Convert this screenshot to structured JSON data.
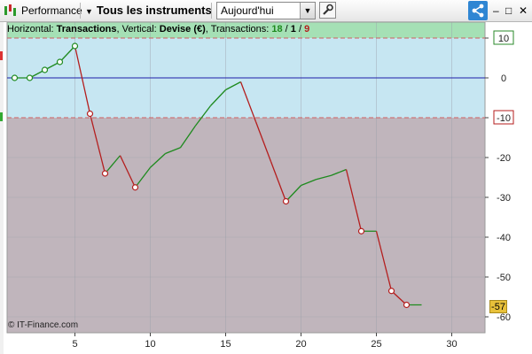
{
  "toolbar": {
    "performance_label": "Performance",
    "instruments_label": "Tous les instruments",
    "period_value": "Aujourd'hui",
    "window_controls": {
      "minimize": "–",
      "maximize": "□",
      "close": "✕"
    }
  },
  "info_bar": {
    "horizontal_prefix": "Horizontal: ",
    "horizontal_value": "Transactions",
    "vertical_prefix": ", Vertical: ",
    "vertical_value": "Devise (€)",
    "transactions_prefix": ", Transactions: ",
    "winning_count": "18",
    "neutral_count": "1",
    "losing_count": "9",
    "slash": " / "
  },
  "reference_lines": {
    "upper_label": "10",
    "zero_label": "0",
    "lower_label": "-10",
    "current_value_label": "-57"
  },
  "copyright": "© IT-Finance.com",
  "colors": {
    "gain": "#1e8a1e",
    "loss": "#b41e1e",
    "zero_line": "#1f1fa8",
    "upper_zone": "#c6e6f2",
    "lower_zone": "#c0b5bc",
    "top_band": "#a5e0b5",
    "badge": "#e8c13a"
  },
  "chart_data": {
    "type": "line",
    "xlabel": "",
    "ylabel": "",
    "xlim": [
      0.5,
      32
    ],
    "ylim": [
      -62,
      15
    ],
    "xticks": [
      5,
      10,
      15,
      20,
      25,
      30
    ],
    "yticks": [
      10,
      0,
      -10,
      -20,
      -30,
      -40,
      -50,
      -60
    ],
    "zones": {
      "upper_threshold": 10,
      "lower_threshold": -10
    },
    "series": [
      {
        "x": [
          1,
          2,
          3,
          4,
          5,
          6,
          7,
          8,
          9,
          10,
          11,
          12,
          13,
          14,
          15,
          16,
          17,
          18,
          19,
          20,
          21,
          22,
          23,
          24,
          25,
          26,
          27,
          28
        ],
        "values": [
          0,
          0,
          2,
          4,
          8,
          -9,
          -24,
          -19.5,
          -27.5,
          -22.5,
          -19,
          -17.5,
          -12,
          -7,
          -3,
          -1,
          -11,
          -21,
          -31,
          -27,
          -25.5,
          -24.5,
          -23,
          -38.5,
          -38.5,
          -53.5,
          -57,
          -57
        ]
      }
    ],
    "markers": [
      {
        "x": 1,
        "y": 0,
        "kind": "gain"
      },
      {
        "x": 2,
        "y": 0,
        "kind": "gain"
      },
      {
        "x": 3,
        "y": 2,
        "kind": "gain"
      },
      {
        "x": 4,
        "y": 4,
        "kind": "gain"
      },
      {
        "x": 5,
        "y": 8,
        "kind": "gain"
      },
      {
        "x": 6,
        "y": -9,
        "kind": "loss"
      },
      {
        "x": 7,
        "y": -24,
        "kind": "loss"
      },
      {
        "x": 9,
        "y": -27.5,
        "kind": "loss"
      },
      {
        "x": 19,
        "y": -31,
        "kind": "loss"
      },
      {
        "x": 24,
        "y": -38.5,
        "kind": "loss"
      },
      {
        "x": 26,
        "y": -53.5,
        "kind": "loss"
      },
      {
        "x": 27,
        "y": -57,
        "kind": "loss"
      }
    ]
  }
}
